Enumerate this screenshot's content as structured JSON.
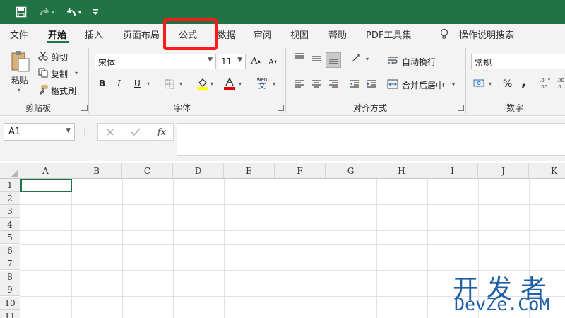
{
  "colors": {
    "accent": "#217346",
    "highlight": "#ff1a1a",
    "watermark": "#1f5fa8"
  },
  "quick_access": [
    {
      "name": "save-icon"
    },
    {
      "name": "redo-icon"
    },
    {
      "name": "undo-icon"
    },
    {
      "name": "customize-qat-icon"
    }
  ],
  "tabs": [
    {
      "label": "文件"
    },
    {
      "label": "开始"
    },
    {
      "label": "插入"
    },
    {
      "label": "页面布局"
    },
    {
      "label": "公式"
    },
    {
      "label": "数据"
    },
    {
      "label": "审阅"
    },
    {
      "label": "视图"
    },
    {
      "label": "帮助"
    },
    {
      "label": "PDF工具集"
    },
    {
      "label": "操作说明搜索"
    }
  ],
  "clipboard": {
    "paste": "粘贴",
    "cut": "剪切",
    "copy": "复制",
    "format_painter": "格式刷",
    "group_label": "剪贴板"
  },
  "font": {
    "font_name": "宋体",
    "font_size": "11",
    "bold": "B",
    "italic": "I",
    "underline": "U",
    "wen_top": "wén",
    "wen_bottom": "文",
    "group_label": "字体"
  },
  "alignment": {
    "wrap_text": "自动换行",
    "merge_center": "合并后居中",
    "group_label": "对齐方式"
  },
  "number": {
    "format": "常规",
    "percent": "%",
    "comma": ",",
    "group_label": "数字"
  },
  "formula_bar": {
    "name_box": "A1",
    "fx": "fx"
  },
  "grid": {
    "columns": [
      "A",
      "B",
      "C",
      "D",
      "E",
      "F",
      "G",
      "H",
      "I",
      "J",
      "K"
    ],
    "rows": [
      "1",
      "2",
      "3",
      "4",
      "5",
      "6",
      "7",
      "8",
      "9",
      "10",
      "11"
    ]
  },
  "watermark": {
    "line1": "开发者",
    "line2": "DevZe.CoM"
  }
}
